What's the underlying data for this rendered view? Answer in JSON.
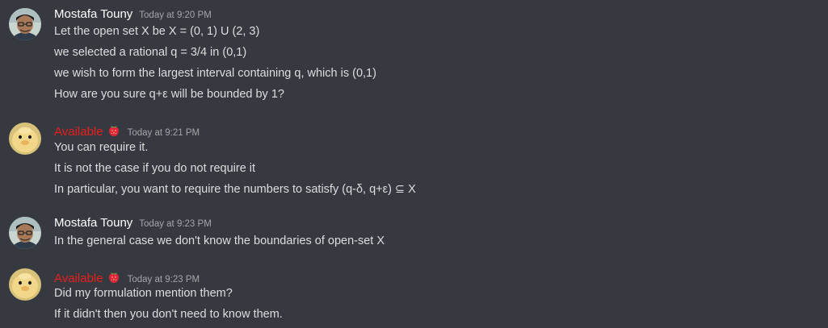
{
  "messages": [
    {
      "author": "Mostafa Touny",
      "author_color": "#ffffff",
      "avatar_icon": "user-avatar-man-glasses",
      "timestamp": "Today at 9:20 PM",
      "lines": [
        "Let the open set X be X = (0, 1) U (2, 3)",
        "we selected a rational q = 3/4 in (0,1)",
        "we wish to form the largest interval containing q, which is (0,1)",
        "How are you sure q+ε will be bounded by 1?"
      ]
    },
    {
      "author": "Available",
      "author_color": "#e91e1e",
      "avatar_icon": "user-avatar-duckling",
      "badge_icon": "strawberry-icon",
      "timestamp": "Today at 9:21 PM",
      "lines": [
        "You can require it.",
        "It is not the case if you do not require it",
        "In particular, you want to require the numbers to satisfy (q-δ, q+ε) ⊆ X"
      ]
    },
    {
      "author": "Mostafa Touny",
      "author_color": "#ffffff",
      "avatar_icon": "user-avatar-man-glasses",
      "timestamp": "Today at 9:23 PM",
      "lines": [
        "In the general case we don't know the boundaries of open-set X"
      ]
    },
    {
      "author": "Available",
      "author_color": "#e91e1e",
      "avatar_icon": "user-avatar-duckling",
      "badge_icon": "strawberry-icon",
      "timestamp": "Today at 9:23 PM",
      "lines": [
        "Did my formulation mention them?",
        "If it didn't then you don't need to know them."
      ]
    }
  ],
  "colors": {
    "background": "#36393f",
    "text": "#dcddde",
    "timestamp": "#a3a6aa"
  }
}
